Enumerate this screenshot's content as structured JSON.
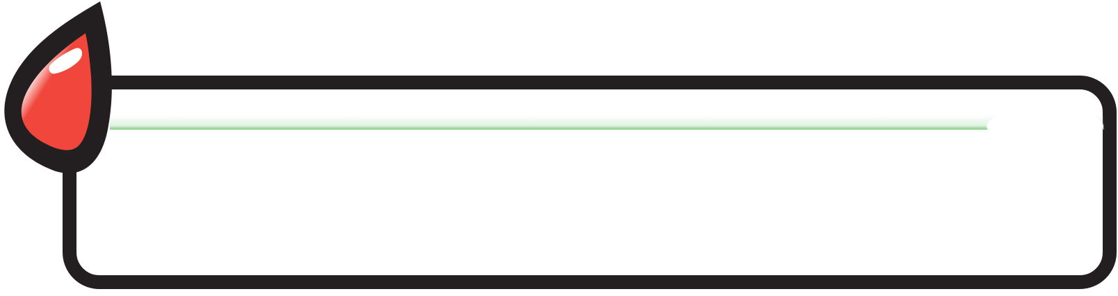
{
  "graphic": {
    "kind": "decorative-banner-frame",
    "icon": "leaf-drop-icon",
    "colors": {
      "outline": "#231f20",
      "leaf_fill": "#f0463c",
      "highlight": "#ffffff",
      "accent_line": "#6cc36f",
      "background": "#ffffff"
    }
  }
}
